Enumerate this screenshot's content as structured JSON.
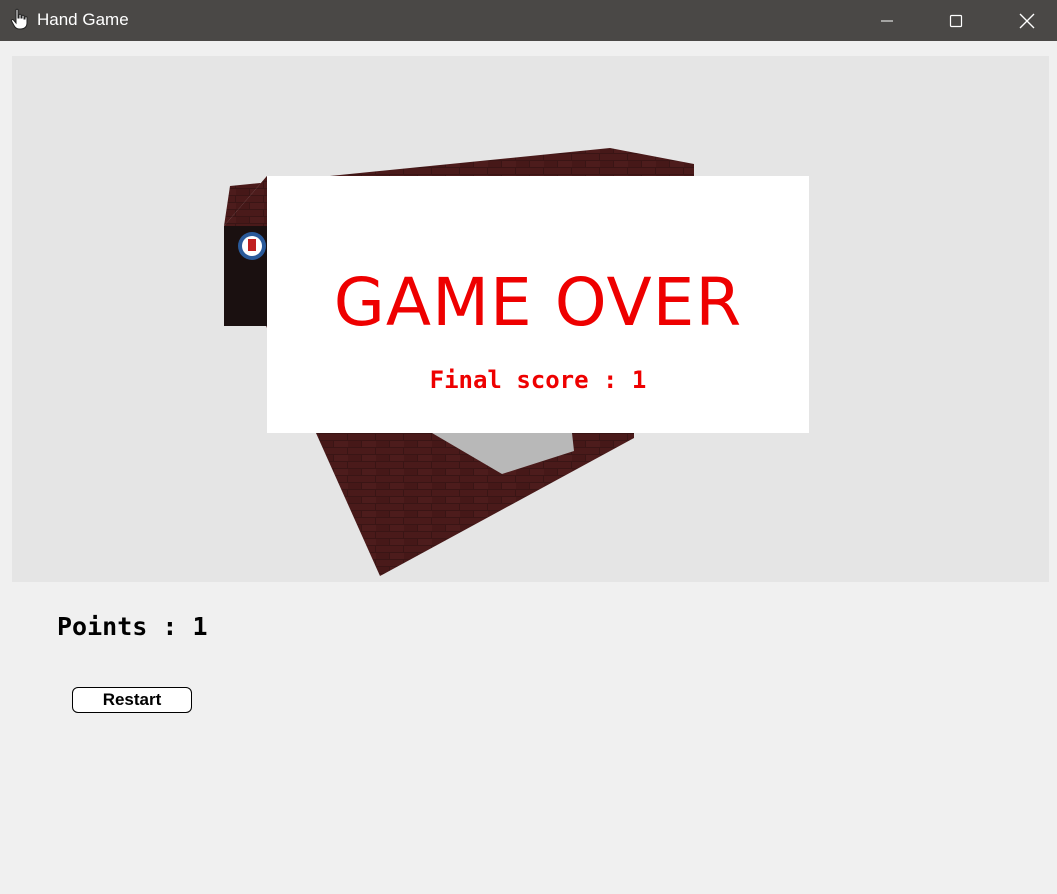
{
  "window": {
    "title": "Hand Game",
    "app_icon": "hand-pointer-icon",
    "controls": {
      "minimize_icon": "minimize-icon",
      "maximize_icon": "maximize-icon",
      "close_icon": "close-icon"
    },
    "titlebar_color": "#4a4846"
  },
  "game": {
    "viewport_background": "#e5e5e5",
    "overlay": {
      "title": "GAME OVER",
      "final_score_text": "Final score : 1",
      "text_color": "#ee0000"
    }
  },
  "hud": {
    "points_text": "Points : 1",
    "restart_label": "Restart"
  }
}
